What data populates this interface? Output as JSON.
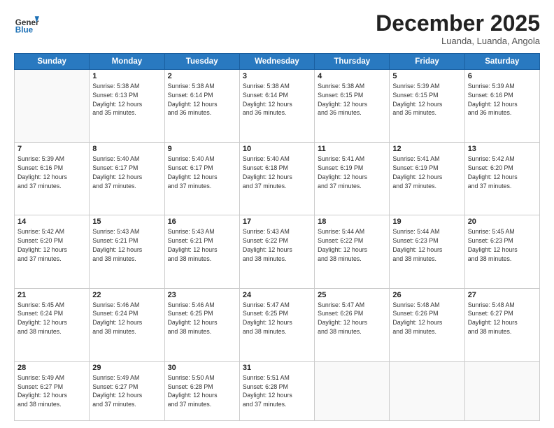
{
  "header": {
    "logo": {
      "general": "General",
      "blue": "Blue"
    },
    "title": "December 2025",
    "subtitle": "Luanda, Luanda, Angola"
  },
  "weekdays": [
    "Sunday",
    "Monday",
    "Tuesday",
    "Wednesday",
    "Thursday",
    "Friday",
    "Saturday"
  ],
  "weeks": [
    [
      {
        "day": "",
        "info": ""
      },
      {
        "day": "1",
        "info": "Sunrise: 5:38 AM\nSunset: 6:13 PM\nDaylight: 12 hours\nand 35 minutes."
      },
      {
        "day": "2",
        "info": "Sunrise: 5:38 AM\nSunset: 6:14 PM\nDaylight: 12 hours\nand 36 minutes."
      },
      {
        "day": "3",
        "info": "Sunrise: 5:38 AM\nSunset: 6:14 PM\nDaylight: 12 hours\nand 36 minutes."
      },
      {
        "day": "4",
        "info": "Sunrise: 5:38 AM\nSunset: 6:15 PM\nDaylight: 12 hours\nand 36 minutes."
      },
      {
        "day": "5",
        "info": "Sunrise: 5:39 AM\nSunset: 6:15 PM\nDaylight: 12 hours\nand 36 minutes."
      },
      {
        "day": "6",
        "info": "Sunrise: 5:39 AM\nSunset: 6:16 PM\nDaylight: 12 hours\nand 36 minutes."
      }
    ],
    [
      {
        "day": "7",
        "info": "Sunrise: 5:39 AM\nSunset: 6:16 PM\nDaylight: 12 hours\nand 37 minutes."
      },
      {
        "day": "8",
        "info": "Sunrise: 5:40 AM\nSunset: 6:17 PM\nDaylight: 12 hours\nand 37 minutes."
      },
      {
        "day": "9",
        "info": "Sunrise: 5:40 AM\nSunset: 6:17 PM\nDaylight: 12 hours\nand 37 minutes."
      },
      {
        "day": "10",
        "info": "Sunrise: 5:40 AM\nSunset: 6:18 PM\nDaylight: 12 hours\nand 37 minutes."
      },
      {
        "day": "11",
        "info": "Sunrise: 5:41 AM\nSunset: 6:19 PM\nDaylight: 12 hours\nand 37 minutes."
      },
      {
        "day": "12",
        "info": "Sunrise: 5:41 AM\nSunset: 6:19 PM\nDaylight: 12 hours\nand 37 minutes."
      },
      {
        "day": "13",
        "info": "Sunrise: 5:42 AM\nSunset: 6:20 PM\nDaylight: 12 hours\nand 37 minutes."
      }
    ],
    [
      {
        "day": "14",
        "info": "Sunrise: 5:42 AM\nSunset: 6:20 PM\nDaylight: 12 hours\nand 37 minutes."
      },
      {
        "day": "15",
        "info": "Sunrise: 5:43 AM\nSunset: 6:21 PM\nDaylight: 12 hours\nand 38 minutes."
      },
      {
        "day": "16",
        "info": "Sunrise: 5:43 AM\nSunset: 6:21 PM\nDaylight: 12 hours\nand 38 minutes."
      },
      {
        "day": "17",
        "info": "Sunrise: 5:43 AM\nSunset: 6:22 PM\nDaylight: 12 hours\nand 38 minutes."
      },
      {
        "day": "18",
        "info": "Sunrise: 5:44 AM\nSunset: 6:22 PM\nDaylight: 12 hours\nand 38 minutes."
      },
      {
        "day": "19",
        "info": "Sunrise: 5:44 AM\nSunset: 6:23 PM\nDaylight: 12 hours\nand 38 minutes."
      },
      {
        "day": "20",
        "info": "Sunrise: 5:45 AM\nSunset: 6:23 PM\nDaylight: 12 hours\nand 38 minutes."
      }
    ],
    [
      {
        "day": "21",
        "info": "Sunrise: 5:45 AM\nSunset: 6:24 PM\nDaylight: 12 hours\nand 38 minutes."
      },
      {
        "day": "22",
        "info": "Sunrise: 5:46 AM\nSunset: 6:24 PM\nDaylight: 12 hours\nand 38 minutes."
      },
      {
        "day": "23",
        "info": "Sunrise: 5:46 AM\nSunset: 6:25 PM\nDaylight: 12 hours\nand 38 minutes."
      },
      {
        "day": "24",
        "info": "Sunrise: 5:47 AM\nSunset: 6:25 PM\nDaylight: 12 hours\nand 38 minutes."
      },
      {
        "day": "25",
        "info": "Sunrise: 5:47 AM\nSunset: 6:26 PM\nDaylight: 12 hours\nand 38 minutes."
      },
      {
        "day": "26",
        "info": "Sunrise: 5:48 AM\nSunset: 6:26 PM\nDaylight: 12 hours\nand 38 minutes."
      },
      {
        "day": "27",
        "info": "Sunrise: 5:48 AM\nSunset: 6:27 PM\nDaylight: 12 hours\nand 38 minutes."
      }
    ],
    [
      {
        "day": "28",
        "info": "Sunrise: 5:49 AM\nSunset: 6:27 PM\nDaylight: 12 hours\nand 38 minutes."
      },
      {
        "day": "29",
        "info": "Sunrise: 5:49 AM\nSunset: 6:27 PM\nDaylight: 12 hours\nand 37 minutes."
      },
      {
        "day": "30",
        "info": "Sunrise: 5:50 AM\nSunset: 6:28 PM\nDaylight: 12 hours\nand 37 minutes."
      },
      {
        "day": "31",
        "info": "Sunrise: 5:51 AM\nSunset: 6:28 PM\nDaylight: 12 hours\nand 37 minutes."
      },
      {
        "day": "",
        "info": ""
      },
      {
        "day": "",
        "info": ""
      },
      {
        "day": "",
        "info": ""
      }
    ]
  ]
}
